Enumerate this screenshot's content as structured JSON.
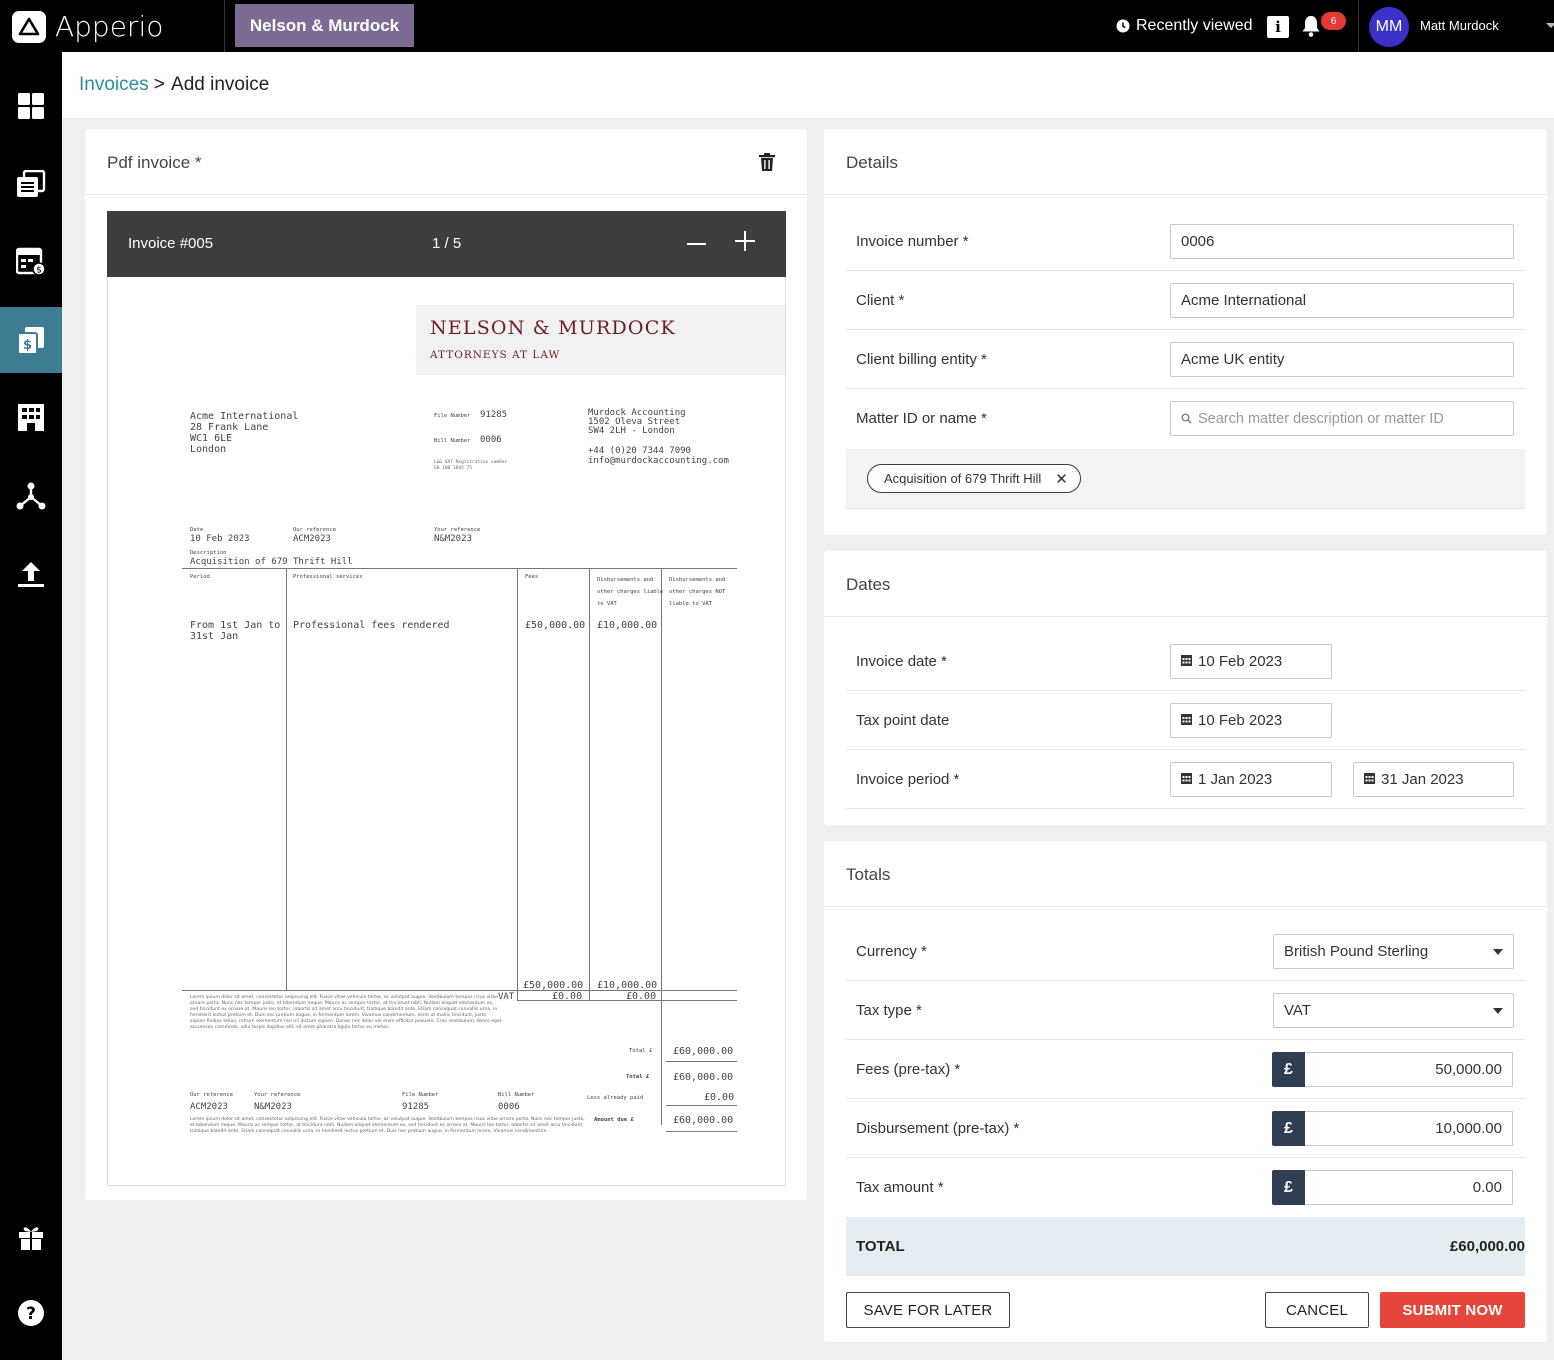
{
  "app": {
    "name": "Apperio",
    "org": "Nelson & Murdock"
  },
  "topbar": {
    "recent": "Recently viewed",
    "notif_count": "6",
    "user_initials": "MM",
    "user_name": "Matt Murdock"
  },
  "sidebar": {
    "icons": [
      "dashboard-icon",
      "documents-icon",
      "ledger-icon",
      "invoices-icon",
      "building-icon",
      "network-icon",
      "upload-icon",
      "gift-icon",
      "help-icon"
    ],
    "active": "invoices-icon"
  },
  "breadcrumb": {
    "link": "Invoices",
    "sep": ">",
    "current": "Add invoice"
  },
  "pdf": {
    "title": "Pdf invoice *",
    "doc_name": "Invoice #005",
    "page": "1 / 5",
    "doc": {
      "firm_name": "NELSON & MURDOCK",
      "firm_sub": "ATTORNEYS AT LAW",
      "client_addr": [
        "Acme International",
        "28 Frank Lane",
        "WC1 6LE",
        "London"
      ],
      "file_number_label": "File Number",
      "file_number": "91285",
      "bill_number_label": "Bill Number",
      "bill_number": "0006",
      "vat_reg_label": "L&G VAT Registration number",
      "vat_reg": "GB 100 1945 75",
      "firm_addr": [
        "Murdock Accounting",
        "1502 Oleva Street",
        "SW4 2LH - London"
      ],
      "firm_contact": [
        "+44 (0)20 7344 7090",
        "info@murdockaccounting.com"
      ],
      "date_label": "Date",
      "date": "10 Feb 2023",
      "our_ref_label": "Our reference",
      "our_ref": "ACM2023",
      "your_ref_label": "Your reference",
      "your_ref": "N&M2023",
      "desc_label": "Description",
      "desc": "Acquisition of 679 Thrift Hill",
      "col_period": "Period",
      "col_services": "Professional services",
      "col_fees": "Fees",
      "col_disb_vat": [
        "Disbursements and",
        "other charges liable",
        "to VAT"
      ],
      "col_disb_novat": [
        "Disbursements and",
        "other charges NOT",
        "liable to VAT"
      ],
      "line_period": [
        "From 1st Jan to",
        "31st Jan"
      ],
      "line_services": "Professional fees rendered",
      "line_fees": "£50,000.00",
      "line_disb": "£10,000.00",
      "sub_fees": "£50,000.00",
      "sub_disb": "£10,000.00",
      "vat_label": "VAT",
      "vat_fees": "£0.00",
      "vat_disb": "£0.00",
      "lorem1": "Lorem ipsum dolor sit amet, consectetur adipiscing elit. Fusce vitae vehicula tortor, ac volutpat augue. Vestibulum tempus risus vitae ornare porta. Nunc nec tempor justo, et bibendum neque. Mauris ac semper tortor, at tincidunt nibh. Nullam aliquet elementum ex, sed tincidunt ex ornare at. Mauris leo tortor, lobortis sit amet arcu tincidunt, tristique blandit ante. Etiam consequat convallis urna, in hendrerit lectus pretium et. Duis nec pretium augue, in fermentum lorem. Vivamus condimentum, enim ut mollis tincidunt, justo sapien finibus tellus, rutrum elementum nisl mi dictum sapien. Donec nec dolor vel enim efficitur posuere. Cras vestibulum, libero eget accumsan commodo, odio turpis dapibus elit, sit amet pharetra ligula tortor eu metus.",
      "total_label": "Total £",
      "total": "£60,000.00",
      "total2_label": "Total £",
      "total2": "£60,000.00",
      "paid_label": "Less already paid",
      "paid": "£0.00",
      "due_label": "Amount due £",
      "due": "£60,000.00",
      "foot_our_ref_label": "Our reference",
      "foot_our_ref": "ACM2023",
      "foot_your_ref_label": "Your reference",
      "foot_your_ref": "N&M2023",
      "foot_file_label": "File Number",
      "foot_file": "91285",
      "foot_bill_label": "Bill Number",
      "foot_bill": "0006",
      "lorem2": "Lorem ipsum dolor sit amet, consectetur adipiscing elit. Fusce vitae vehicula tortor, ac volutpat augue. Vestibulum tempus risus vitae ornare porta. Nunc nec tempor justo, et bibendum neque. Mauris ac semper tortor, at tincidunt nibh. Nullam aliquet elementum ex, sed tincidunt ex ornare at. Mauris leo tortor, lobortis sit amet arcu tincidunt, tristique blandit ante. Etiam consequat convallis urna, in hendrerit lectus pretium et. Duis nec pretium augue, in fermentum lorem. Vivamus condimentum."
    }
  },
  "details": {
    "title": "Details",
    "invoice_number_label": "Invoice number *",
    "invoice_number": "0006",
    "client_label": "Client *",
    "client": "Acme International",
    "billing_label": "Client billing entity *",
    "billing": "Acme UK entity",
    "matter_label": "Matter ID or name *",
    "matter_placeholder": "Search matter description or matter ID",
    "matter_chip": "Acquisition of 679 Thrift Hill"
  },
  "dates": {
    "title": "Dates",
    "invoice_date_label": "Invoice date *",
    "invoice_date": "10 Feb 2023",
    "tax_point_label": "Tax point date",
    "tax_point": "10 Feb 2023",
    "period_label": "Invoice period *",
    "period_start": "1 Jan 2023",
    "period_end": "31 Jan 2023"
  },
  "totals": {
    "title": "Totals",
    "currency_label": "Currency *",
    "currency": "British Pound Sterling",
    "tax_type_label": "Tax type *",
    "tax_type": "VAT",
    "fees_label": "Fees (pre-tax) *",
    "fees": "50,000.00",
    "disb_label": "Disbursement (pre-tax) *",
    "disb": "10,000.00",
    "tax_label": "Tax amount *",
    "tax": "0.00",
    "currency_symbol": "£",
    "total_label": "TOTAL",
    "total": "£60,000.00"
  },
  "actions": {
    "save_later": "SAVE FOR LATER",
    "cancel": "CANCEL",
    "submit": "SUBMIT NOW"
  },
  "colors": {
    "accent": "#3d7c93",
    "org_chip": "#7e6b94",
    "submit": "#e5453b",
    "link": "#2b8ea0",
    "currency_box": "#2f3e52"
  }
}
